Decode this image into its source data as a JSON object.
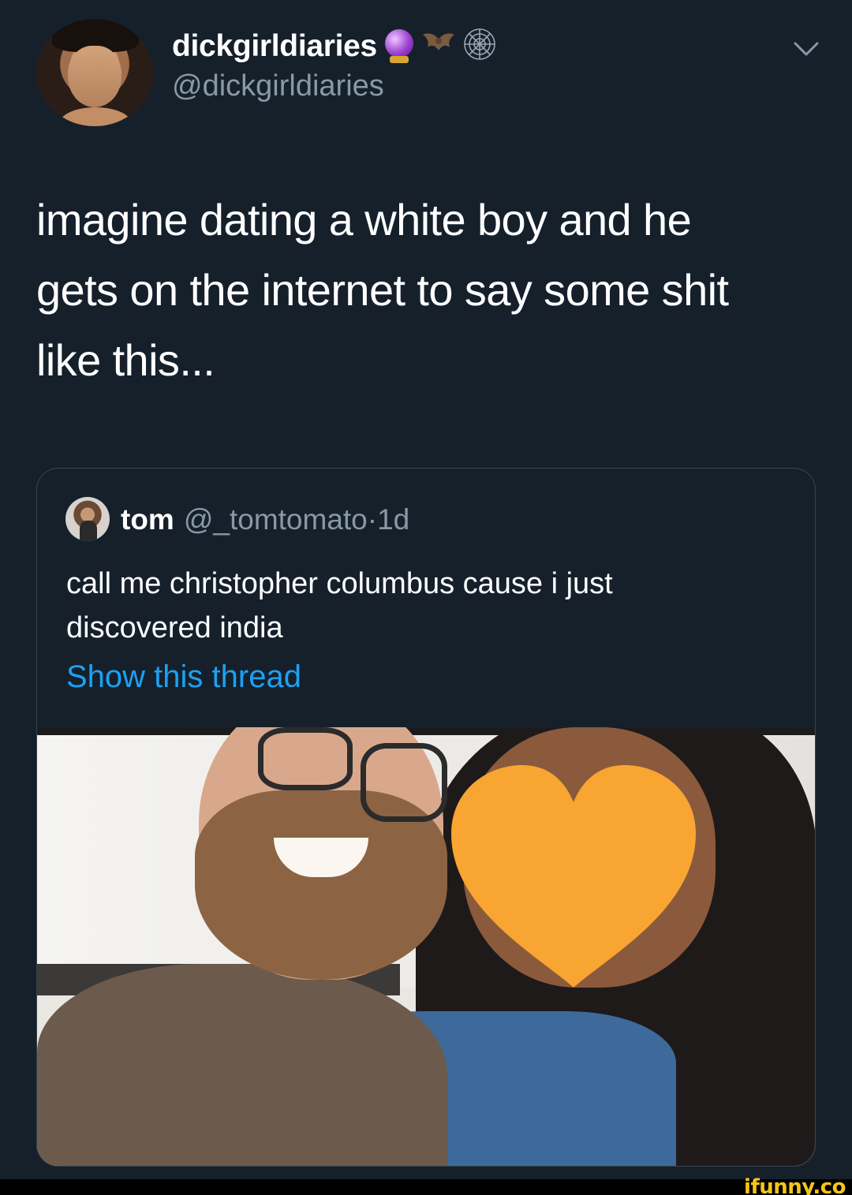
{
  "tweet": {
    "display_name": "dickgirldiaries",
    "name_emojis": [
      "crystal-ball",
      "bat",
      "spider-web"
    ],
    "handle": "@dickgirldiaries",
    "text": "imagine dating a white boy and he\ngets on the internet to say some shit\nlike this..."
  },
  "quoted_tweet": {
    "display_name": "tom",
    "handle": "@_tomtomato",
    "separator": "·",
    "time": "1d",
    "text": "call me christopher columbus cause i just\ndiscovered india",
    "show_thread": "Show this thread"
  },
  "watermark": "ifunny.co",
  "colors": {
    "background": "#15202b",
    "secondary_text": "#8899a6",
    "link": "#1da1f2",
    "border": "#38444d",
    "heart": "#f8a532"
  }
}
